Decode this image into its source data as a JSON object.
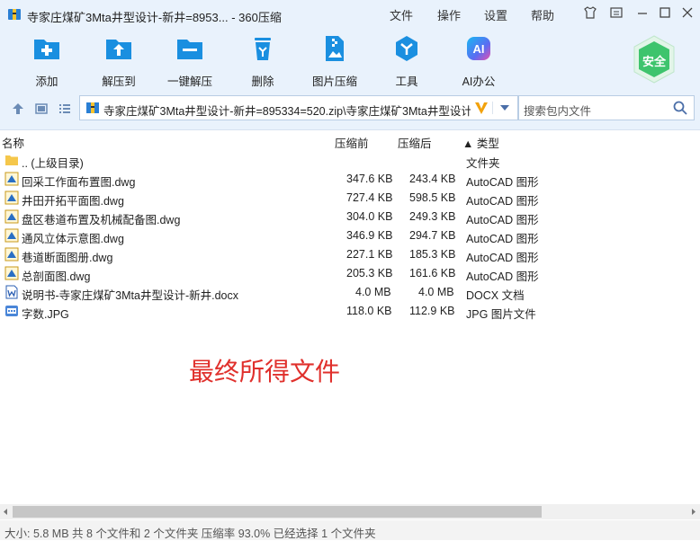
{
  "window": {
    "title": "寺家庄煤矿3Mta井型设计-新井=8953... - 360压缩",
    "menu": [
      "文件",
      "操作",
      "设置",
      "帮助"
    ]
  },
  "toolbar": {
    "buttons": [
      {
        "label": "添加",
        "icon": "add-icon"
      },
      {
        "label": "解压到",
        "icon": "extract-to-icon"
      },
      {
        "label": "一键解压",
        "icon": "one-click-extract-icon"
      },
      {
        "label": "删除",
        "icon": "delete-icon"
      },
      {
        "label": "图片压缩",
        "icon": "image-compress-icon"
      },
      {
        "label": "工具",
        "icon": "tools-icon"
      },
      {
        "label": "AI办公",
        "icon": "ai-office-icon"
      }
    ],
    "safe_badge": "安全"
  },
  "address": {
    "path": "寺家庄煤矿3Mta井型设计-新井=895334=520.zip\\寺家庄煤矿3Mta井型设计",
    "search_placeholder": "搜索包内文件"
  },
  "columns": {
    "name": "名称",
    "compressed_before": "压缩前",
    "compressed_after": "压缩后",
    "type": "▲ 类型"
  },
  "files": [
    {
      "name": ".. (上级目录)",
      "before": "",
      "after": "",
      "type": "文件夹",
      "icon": "folder-icon"
    },
    {
      "name": "回采工作面布置图.dwg",
      "before": "347.6 KB",
      "after": "243.4 KB",
      "type": "AutoCAD 图形",
      "icon": "dwg-file-icon"
    },
    {
      "name": "井田开拓平面图.dwg",
      "before": "727.4 KB",
      "after": "598.5 KB",
      "type": "AutoCAD 图形",
      "icon": "dwg-file-icon"
    },
    {
      "name": "盘区巷道布置及机械配备图.dwg",
      "before": "304.0 KB",
      "after": "249.3 KB",
      "type": "AutoCAD 图形",
      "icon": "dwg-file-icon"
    },
    {
      "name": "通风立体示意图.dwg",
      "before": "346.9 KB",
      "after": "294.7 KB",
      "type": "AutoCAD 图形",
      "icon": "dwg-file-icon"
    },
    {
      "name": "巷道断面图册.dwg",
      "before": "227.1 KB",
      "after": "185.3 KB",
      "type": "AutoCAD 图形",
      "icon": "dwg-file-icon"
    },
    {
      "name": "总剖面图.dwg",
      "before": "205.3 KB",
      "after": "161.6 KB",
      "type": "AutoCAD 图形",
      "icon": "dwg-file-icon"
    },
    {
      "name": "说明书-寺家庄煤矿3Mta井型设计-新井.docx",
      "before": "4.0 MB",
      "after": "4.0 MB",
      "type": "DOCX 文档",
      "icon": "docx-file-icon"
    },
    {
      "name": "字数.JPG",
      "before": "118.0 KB",
      "after": "112.9 KB",
      "type": "JPG 图片文件",
      "icon": "jpg-file-icon"
    }
  ],
  "annotation": "最终所得文件",
  "statusbar": "大小: 5.8 MB 共 8 个文件和 2 个文件夹 压缩率 93.0% 已经选择 1 个文件夹",
  "colors": {
    "chrome": "#e9f2fc",
    "accent": "#1a8fe0",
    "note": "#e0302c",
    "safe": "#3ec46d"
  }
}
